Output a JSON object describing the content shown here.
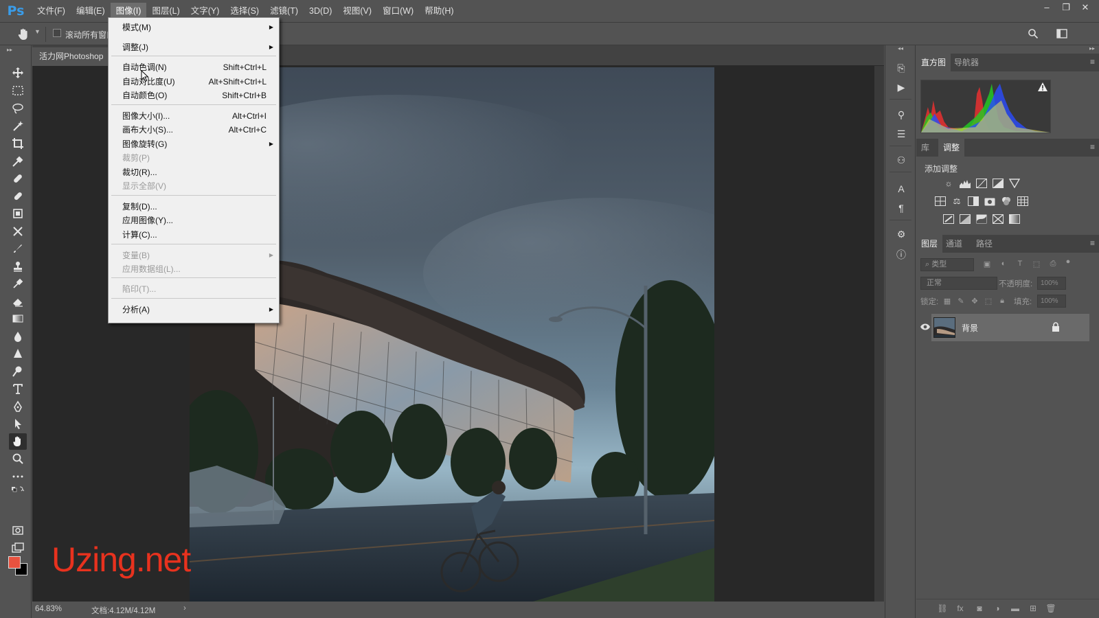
{
  "app": {
    "logo": "Ps"
  },
  "menubar": {
    "items": [
      "文件(F)",
      "编辑(E)",
      "图像(I)",
      "图层(L)",
      "文字(Y)",
      "选择(S)",
      "滤镜(T)",
      "3D(D)",
      "视图(V)",
      "窗口(W)",
      "帮助(H)"
    ],
    "active_index": 2,
    "window_controls": [
      "minimize-icon",
      "restore-icon",
      "close-icon"
    ]
  },
  "options_bar": {
    "tool_icon": "hand-icon",
    "checkbox_label": "滚动所有窗口",
    "checkbox_checked": false
  },
  "document": {
    "tab_title": "活力网Photoshop",
    "zoom": "64.83%",
    "doc_size": "文档:4.12M/4.12M"
  },
  "image_menu": {
    "items": [
      {
        "label": "模式(M)",
        "shortcut": "",
        "submenu": true,
        "disabled": false
      },
      {
        "label": "调整(J)",
        "shortcut": "",
        "submenu": true,
        "disabled": false
      },
      {
        "label": "自动色调(N)",
        "shortcut": "Shift+Ctrl+L",
        "submenu": false,
        "disabled": false
      },
      {
        "label": "自动对比度(U)",
        "shortcut": "Alt+Shift+Ctrl+L",
        "submenu": false,
        "disabled": false
      },
      {
        "label": "自动颜色(O)",
        "shortcut": "Shift+Ctrl+B",
        "submenu": false,
        "disabled": false
      },
      {
        "label": "图像大小(I)...",
        "shortcut": "Alt+Ctrl+I",
        "submenu": false,
        "disabled": false
      },
      {
        "label": "画布大小(S)...",
        "shortcut": "Alt+Ctrl+C",
        "submenu": false,
        "disabled": false
      },
      {
        "label": "图像旋转(G)",
        "shortcut": "",
        "submenu": true,
        "disabled": false
      },
      {
        "label": "裁剪(P)",
        "shortcut": "",
        "submenu": false,
        "disabled": true
      },
      {
        "label": "裁切(R)...",
        "shortcut": "",
        "submenu": false,
        "disabled": false
      },
      {
        "label": "显示全部(V)",
        "shortcut": "",
        "submenu": false,
        "disabled": true
      },
      {
        "label": "复制(D)...",
        "shortcut": "",
        "submenu": false,
        "disabled": false
      },
      {
        "label": "应用图像(Y)...",
        "shortcut": "",
        "submenu": false,
        "disabled": false
      },
      {
        "label": "计算(C)...",
        "shortcut": "",
        "submenu": false,
        "disabled": false
      },
      {
        "label": "变量(B)",
        "shortcut": "",
        "submenu": true,
        "disabled": true
      },
      {
        "label": "应用数据组(L)...",
        "shortcut": "",
        "submenu": false,
        "disabled": true
      },
      {
        "label": "陷印(T)...",
        "shortcut": "",
        "submenu": false,
        "disabled": true
      },
      {
        "label": "分析(A)",
        "shortcut": "",
        "submenu": true,
        "disabled": false
      }
    ]
  },
  "panels": {
    "top_tabs": [
      "直方图",
      "导航器"
    ],
    "top_active": 0,
    "mid_tabs": [
      "库",
      "调整"
    ],
    "mid_active": 1,
    "add_adjustment_label": "添加调整",
    "adjust_icons": [
      [
        "brightness-icon",
        "levels-icon",
        "curves-icon",
        "exposure-icon",
        "vibrance-icon"
      ],
      [
        "hue-saturation-icon",
        "color-balance-icon",
        "black-white-icon",
        "photo-filter-icon",
        "channel-mixer-icon",
        "color-lookup-icon"
      ],
      [
        "invert-icon",
        "posterize-icon",
        "threshold-icon",
        "selective-color-icon",
        "gradient-map-icon"
      ]
    ],
    "layer_tabs": [
      "图层",
      "通道",
      "路径"
    ],
    "layer_active": 0,
    "filter_placeholder": "类型",
    "blend_mode": "正常",
    "opacity_label": "不透明度:",
    "opacity_value": "100%",
    "lock_label": "锁定:",
    "fill_label": "填充:",
    "fill_value": "100%",
    "layers": [
      {
        "name": "背景",
        "visible": true,
        "locked": true
      }
    ]
  },
  "watermark": "Uzing.net",
  "colors": {
    "foreground": "#e8523f",
    "background": "#000000",
    "ui_bg": "#535353",
    "canvas_bg": "#282828",
    "accent": "#3a9ce8"
  }
}
